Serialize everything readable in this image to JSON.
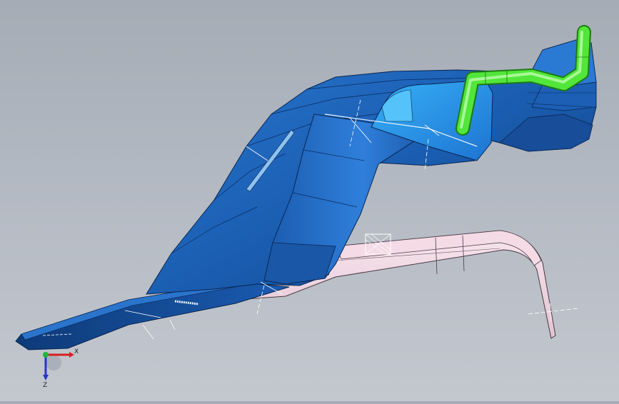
{
  "viewport": {
    "background_top": "#a6acb5",
    "background_bottom": "#c3c8cf"
  },
  "model": {
    "parts": [
      {
        "id": "main-shell",
        "color": "#1f63b8"
      },
      {
        "id": "side-panel",
        "color": "#2e79d6"
      },
      {
        "id": "highlight-panel",
        "color": "#2fa3f0"
      },
      {
        "id": "wire-harness",
        "color": "#4ee23a"
      },
      {
        "id": "lower-tray",
        "color": "#f2d6e2"
      }
    ]
  },
  "triad": {
    "x_label": "X",
    "y_label": "Y",
    "z_label": "Z",
    "x_color": "#d62020",
    "y_color": "#1fb53a",
    "z_color": "#2a34c8"
  }
}
